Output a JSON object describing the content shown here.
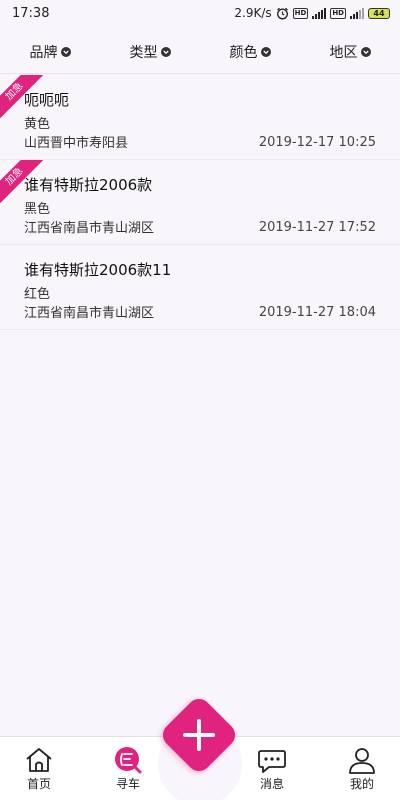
{
  "status_bar": {
    "time": "17:38",
    "speed": "2.9K/s",
    "battery": "44"
  },
  "filters": [
    {
      "label": "品牌"
    },
    {
      "label": "类型"
    },
    {
      "label": "颜色"
    },
    {
      "label": "地区"
    }
  ],
  "listings": [
    {
      "title": "呃呃呃",
      "color": "黄色",
      "location": "山西晋中市寿阳县",
      "time": "2019-12-17 10:25",
      "urgent": "加急"
    },
    {
      "title": "谁有特斯拉2006款",
      "color": "黑色",
      "location": "江西省南昌市青山湖区",
      "time": "2019-11-27 17:52",
      "urgent": "加急"
    },
    {
      "title": "谁有特斯拉2006款11",
      "color": "红色",
      "location": "江西省南昌市青山湖区",
      "time": "2019-11-27 18:04"
    }
  ],
  "nav": {
    "home": "首页",
    "find_car": "寻车",
    "messages": "消息",
    "mine": "我的"
  },
  "colors": {
    "accent": "#e0237e"
  }
}
